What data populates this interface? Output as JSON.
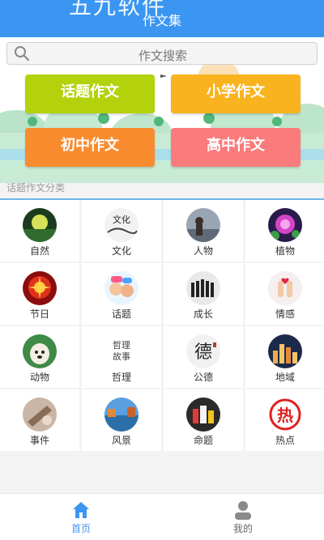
{
  "header": {
    "watermark": "五九软件",
    "title": "作文集"
  },
  "search": {
    "placeholder": "作文搜索"
  },
  "categories": [
    {
      "label": "话题作文",
      "color": "#b4d20c"
    },
    {
      "label": "小学作文",
      "color": "#f8b31f"
    },
    {
      "label": "初中作文",
      "color": "#fa8c30"
    },
    {
      "label": "高中作文",
      "color": "#fa7b7b"
    }
  ],
  "section": {
    "label": "话题作文分类"
  },
  "topics": [
    {
      "label": "自然",
      "icon": "nature-icon"
    },
    {
      "label": "文化",
      "icon": "culture-icon"
    },
    {
      "label": "人物",
      "icon": "person-icon"
    },
    {
      "label": "植物",
      "icon": "plant-icon"
    },
    {
      "label": "节日",
      "icon": "festival-icon"
    },
    {
      "label": "话题",
      "icon": "topic-icon"
    },
    {
      "label": "成长",
      "icon": "growth-icon"
    },
    {
      "label": "情感",
      "icon": "emotion-icon"
    },
    {
      "label": "动物",
      "icon": "animal-icon"
    },
    {
      "label": "哲理",
      "icon": "philosophy-icon"
    },
    {
      "label": "公德",
      "icon": "morality-icon"
    },
    {
      "label": "地域",
      "icon": "region-icon"
    },
    {
      "label": "事件",
      "icon": "event-icon"
    },
    {
      "label": "风景",
      "icon": "scenery-icon"
    },
    {
      "label": "命题",
      "icon": "proposition-icon"
    },
    {
      "label": "热点",
      "icon": "hot-icon"
    }
  ],
  "philosophy_icon_text": "哲理故事",
  "morality_icon_text": "德",
  "hot_icon_text": "热",
  "culture_icon_text": "文化",
  "tabs": [
    {
      "label": "首页",
      "active": true,
      "color": "#3b96f2"
    },
    {
      "label": "我的",
      "active": false,
      "color": "#777777"
    }
  ]
}
